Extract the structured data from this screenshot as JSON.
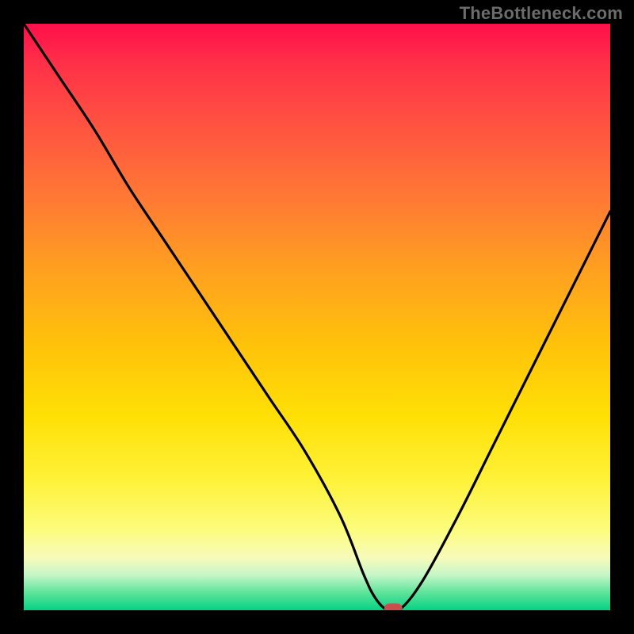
{
  "watermark": "TheBottleneck.com",
  "chart_data": {
    "type": "line",
    "title": "",
    "xlabel": "",
    "ylabel": "",
    "xlim": [
      0,
      100
    ],
    "ylim": [
      0,
      100
    ],
    "grid": false,
    "legend": false,
    "annotations": [],
    "series": [
      {
        "name": "bottleneck-curve",
        "x": [
          0,
          6,
          12,
          18,
          24,
          30,
          36,
          42,
          48,
          54,
          58,
          60,
          62,
          64,
          68,
          74,
          80,
          86,
          92,
          100
        ],
        "values": [
          100,
          91,
          82,
          72,
          63,
          54,
          45,
          36,
          27,
          16,
          6,
          2,
          0,
          0,
          5,
          16,
          28,
          40,
          52,
          68
        ]
      }
    ],
    "optimal_point": {
      "x": 63,
      "y": 0
    },
    "background_gradient": {
      "stops": [
        {
          "pos": 0.0,
          "color": "#ff0f4a"
        },
        {
          "pos": 0.3,
          "color": "#ff7a34"
        },
        {
          "pos": 0.55,
          "color": "#ffc30a"
        },
        {
          "pos": 0.78,
          "color": "#fff23a"
        },
        {
          "pos": 0.91,
          "color": "#f8fbb9"
        },
        {
          "pos": 1.0,
          "color": "#06d183"
        }
      ]
    }
  }
}
